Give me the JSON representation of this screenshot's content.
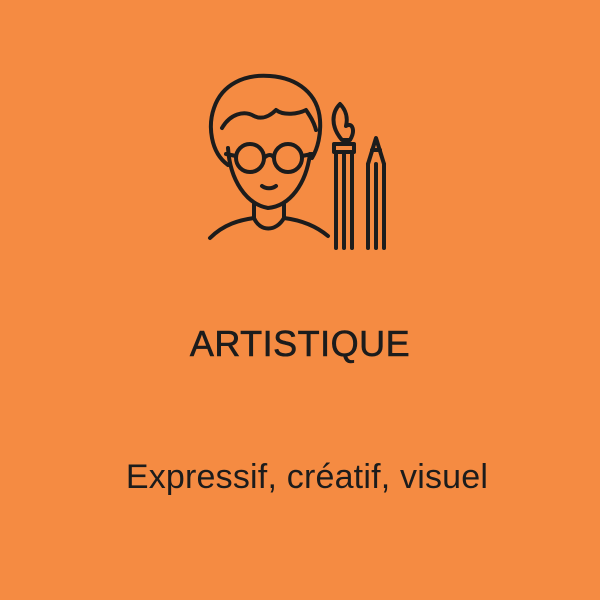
{
  "card": {
    "background_color": "#F58B42",
    "text_color": "#1C1C1C",
    "icon": "artist-with-glasses-and-brushes-icon",
    "title": "ARTISTIQUE",
    "description": "Expressif, créatif, visuel"
  }
}
